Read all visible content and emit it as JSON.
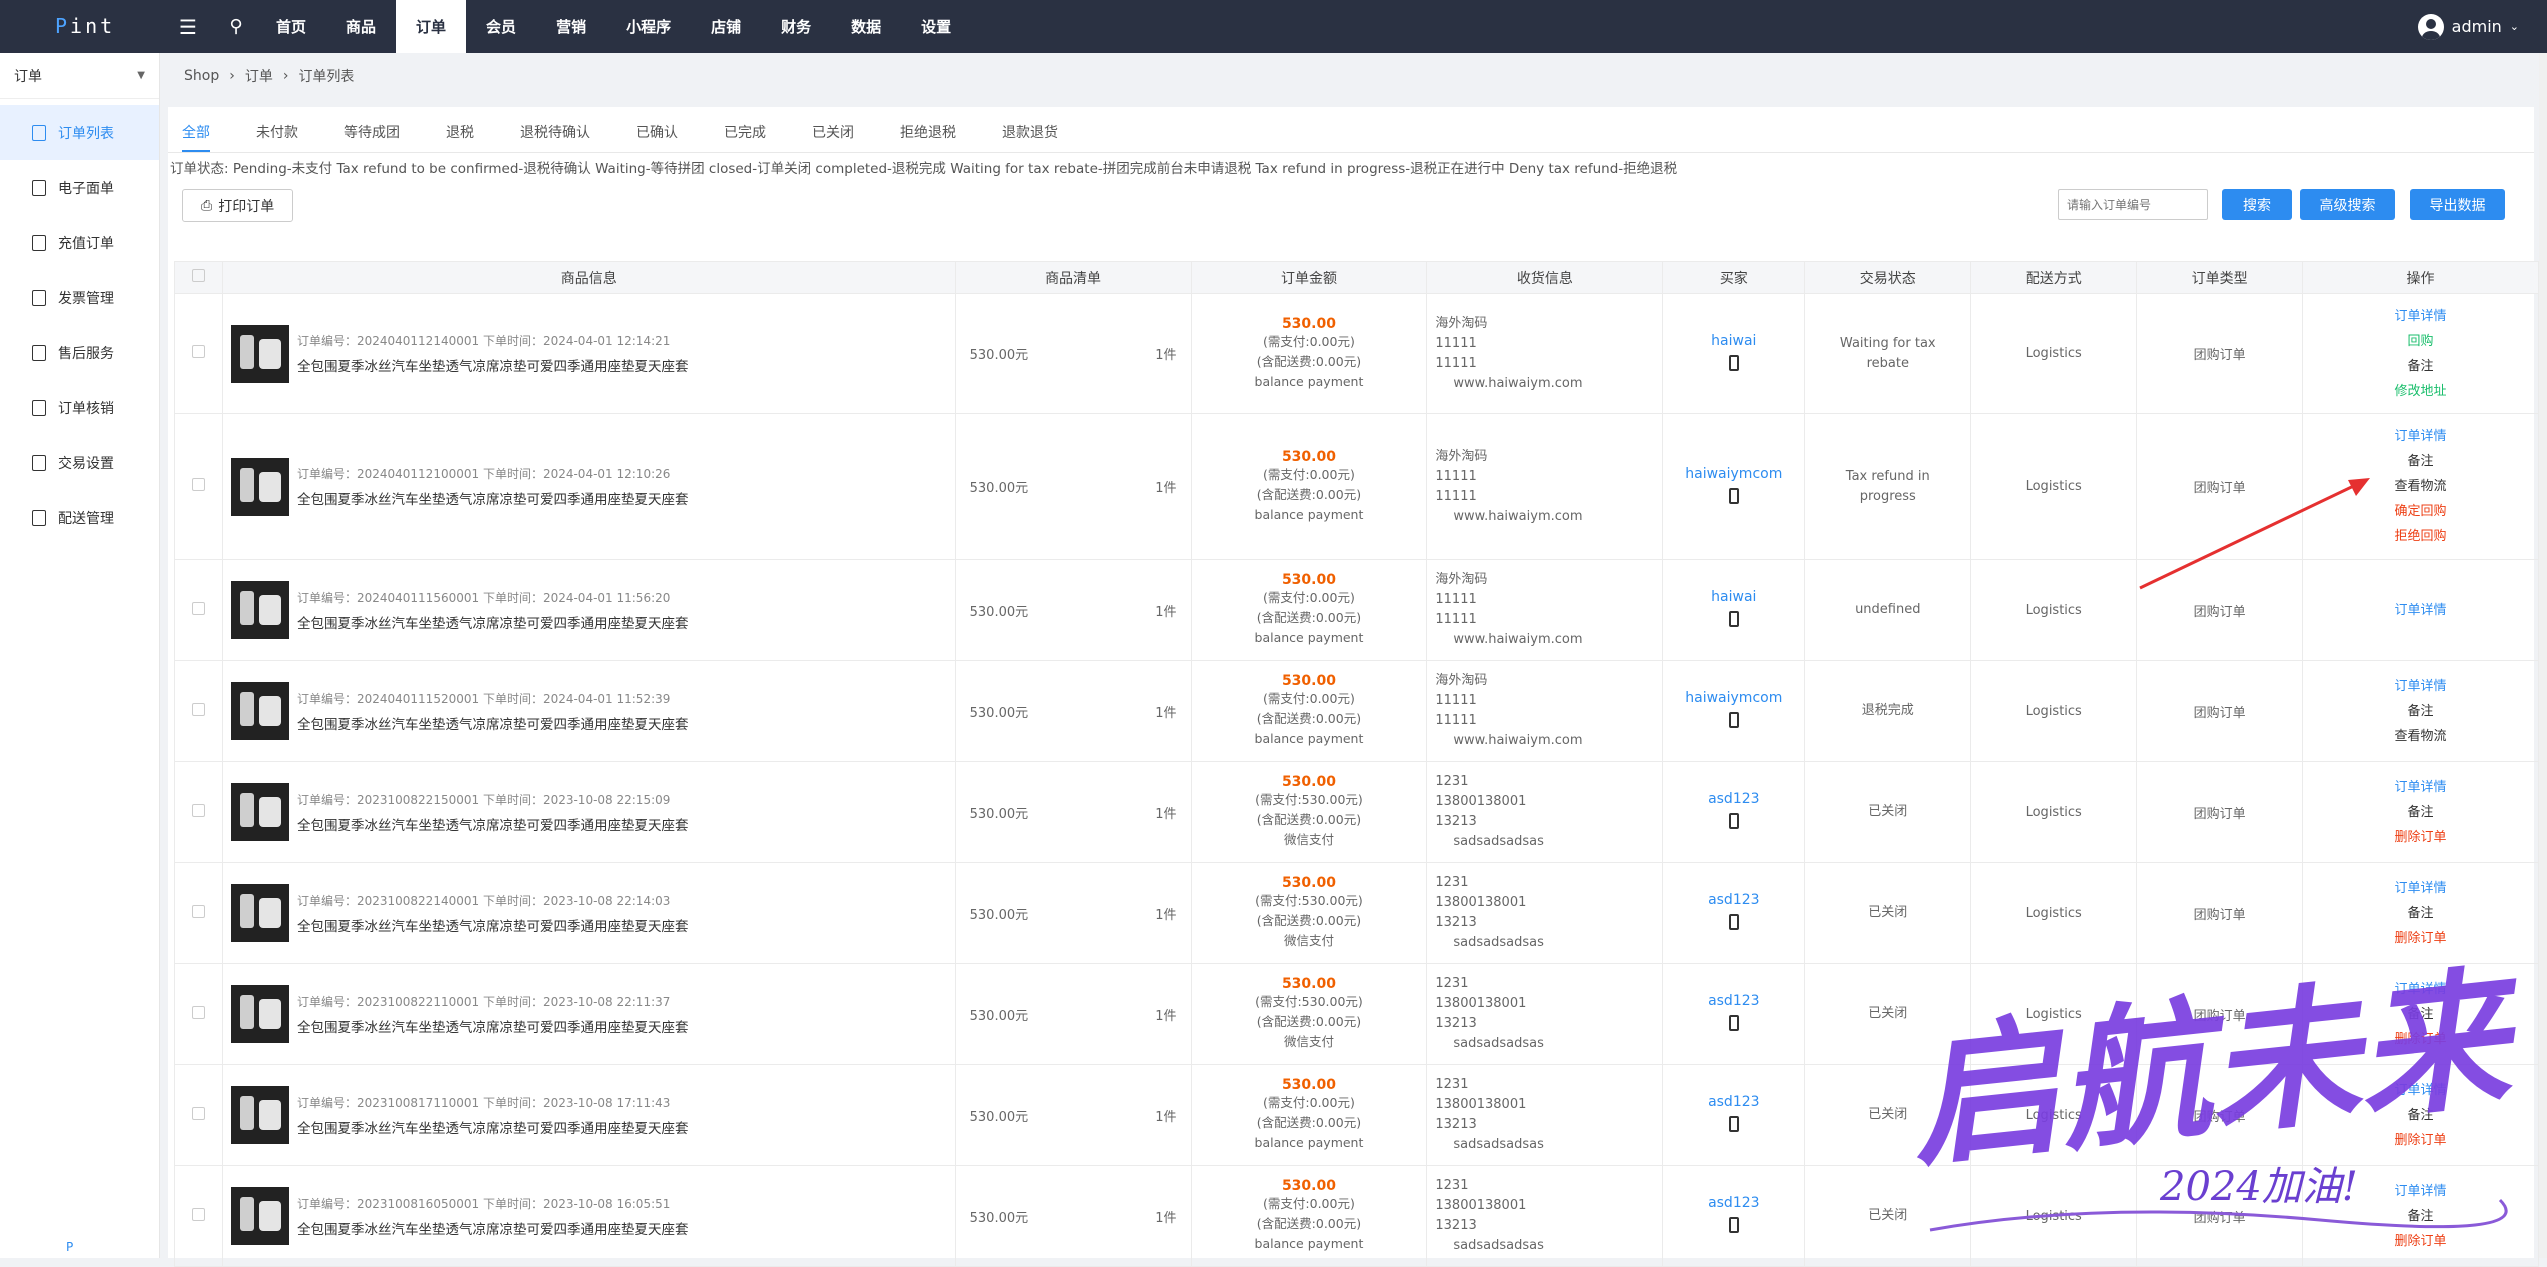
{
  "topbar": {
    "logo_p": "P",
    "logo_rest": "int",
    "nav": [
      "首页",
      "商品",
      "订单",
      "会员",
      "营销",
      "小程序",
      "店铺",
      "财务",
      "数据",
      "设置"
    ],
    "active_nav": 2,
    "user": "admin"
  },
  "sidebar": {
    "head": "订单",
    "items": [
      "订单列表",
      "电子面单",
      "充值订单",
      "发票管理",
      "售后服务",
      "订单核销",
      "交易设置",
      "配送管理"
    ],
    "active": 0,
    "foot": "P"
  },
  "breadcrumb": [
    "Shop",
    "订单",
    "订单列表"
  ],
  "tabs": [
    "全部",
    "未付款",
    "等待成团",
    "退税",
    "退税待确认",
    "已确认",
    "已完成",
    "已关闭",
    "拒绝退税",
    "退款退货"
  ],
  "active_tab": 0,
  "status_text": "订单状态: Pending-未支付 Tax refund to be confirmed-退税待确认 Waiting-等待拼团 closed-订单关闭 completed-退税完成 Waiting for tax rebate-拼团完成前台未申请退税 Tax refund in progress-退税正在进行中 Deny tax refund-拒绝退税",
  "toolbar": {
    "print": "打印订单",
    "search_placeholder": "请输入订单编号",
    "search": "搜索",
    "advanced": "高级搜索",
    "export": "导出数据"
  },
  "columns": [
    "商品信息",
    "商品清单",
    "订单金额",
    "收货信息",
    "买家",
    "交易状态",
    "配送方式",
    "订单类型",
    "操作"
  ],
  "goods_name": "全包围夏季冰丝汽车坐垫透气凉席凉垫可爱四季通用座垫夏天座套",
  "rows": [
    {
      "meta": "订单编号：2024040112140001 下单时间：2024-04-01 12:14:21",
      "price": "530.00元",
      "qty": "1件",
      "amount": "530.00",
      "need": "(需支付:0.00元)",
      "ship": "(含配送费:0.00元)",
      "pay": "balance payment",
      "r1": "海外淘码",
      "r2": "11111",
      "r3": "11111",
      "r4": "www.haiwaiym.com",
      "buyer": "haiwai",
      "status": "Waiting for tax rebate",
      "delivery": "Logistics",
      "type": "团购订单",
      "ops": [
        [
          "订单详情",
          "op-blue"
        ],
        [
          "回购",
          "op-green"
        ],
        [
          "备注",
          "op-dark"
        ],
        [
          "修改地址",
          "op-green2"
        ]
      ]
    },
    {
      "meta": "订单编号：2024040112100001 下单时间：2024-04-01 12:10:26",
      "price": "530.00元",
      "qty": "1件",
      "amount": "530.00",
      "need": "(需支付:0.00元)",
      "ship": "(含配送费:0.00元)",
      "pay": "balance payment",
      "r1": "海外淘码",
      "r2": "11111",
      "r3": "11111",
      "r4": "www.haiwaiym.com",
      "buyer": "haiwaiymcom",
      "status": "Tax refund in progress",
      "delivery": "Logistics",
      "type": "团购订单",
      "ops": [
        [
          "订单详情",
          "op-blue"
        ],
        [
          "备注",
          "op-dark"
        ],
        [
          "查看物流",
          "op-dark"
        ],
        [
          "确定回购",
          "op-red"
        ],
        [
          "拒绝回购",
          "op-red"
        ]
      ]
    },
    {
      "meta": "订单编号：2024040111560001 下单时间：2024-04-01 11:56:20",
      "price": "530.00元",
      "qty": "1件",
      "amount": "530.00",
      "need": "(需支付:0.00元)",
      "ship": "(含配送费:0.00元)",
      "pay": "balance payment",
      "r1": "海外淘码",
      "r2": "11111",
      "r3": "11111",
      "r4": "www.haiwaiym.com",
      "buyer": "haiwai",
      "status": "undefined",
      "delivery": "Logistics",
      "type": "团购订单",
      "ops": [
        [
          "订单详情",
          "op-blue"
        ]
      ]
    },
    {
      "meta": "订单编号：2024040111520001 下单时间：2024-04-01 11:52:39",
      "price": "530.00元",
      "qty": "1件",
      "amount": "530.00",
      "need": "(需支付:0.00元)",
      "ship": "(含配送费:0.00元)",
      "pay": "balance payment",
      "r1": "海外淘码",
      "r2": "11111",
      "r3": "11111",
      "r4": "www.haiwaiym.com",
      "buyer": "haiwaiymcom",
      "status": "退税完成",
      "delivery": "Logistics",
      "type": "团购订单",
      "ops": [
        [
          "订单详情",
          "op-blue"
        ],
        [
          "备注",
          "op-dark"
        ],
        [
          "查看物流",
          "op-dark"
        ]
      ]
    },
    {
      "meta": "订单编号：2023100822150001 下单时间：2023-10-08 22:15:09",
      "price": "530.00元",
      "qty": "1件",
      "amount": "530.00",
      "need": "(需支付:530.00元)",
      "ship": "(含配送费:0.00元)",
      "pay": "微信支付",
      "r1": "1231",
      "r2": "13800138001",
      "r3": "13213",
      "r4": "sadsadsadsas",
      "buyer": "asd123",
      "status": "已关闭",
      "delivery": "Logistics",
      "type": "团购订单",
      "ops": [
        [
          "订单详情",
          "op-blue"
        ],
        [
          "备注",
          "op-dark"
        ],
        [
          "删除订单",
          "op-red"
        ]
      ]
    },
    {
      "meta": "订单编号：2023100822140001 下单时间：2023-10-08 22:14:03",
      "price": "530.00元",
      "qty": "1件",
      "amount": "530.00",
      "need": "(需支付:530.00元)",
      "ship": "(含配送费:0.00元)",
      "pay": "微信支付",
      "r1": "1231",
      "r2": "13800138001",
      "r3": "13213",
      "r4": "sadsadsadsas",
      "buyer": "asd123",
      "status": "已关闭",
      "delivery": "Logistics",
      "type": "团购订单",
      "ops": [
        [
          "订单详情",
          "op-blue"
        ],
        [
          "备注",
          "op-dark"
        ],
        [
          "删除订单",
          "op-red"
        ]
      ]
    },
    {
      "meta": "订单编号：2023100822110001 下单时间：2023-10-08 22:11:37",
      "price": "530.00元",
      "qty": "1件",
      "amount": "530.00",
      "need": "(需支付:530.00元)",
      "ship": "(含配送费:0.00元)",
      "pay": "微信支付",
      "r1": "1231",
      "r2": "13800138001",
      "r3": "13213",
      "r4": "sadsadsadsas",
      "buyer": "asd123",
      "status": "已关闭",
      "delivery": "Logistics",
      "type": "团购订单",
      "ops": [
        [
          "订单详情",
          "op-blue"
        ],
        [
          "备注",
          "op-dark"
        ],
        [
          "删除订单",
          "op-red"
        ]
      ]
    },
    {
      "meta": "订单编号：2023100817110001 下单时间：2023-10-08 17:11:43",
      "price": "530.00元",
      "qty": "1件",
      "amount": "530.00",
      "need": "(需支付:0.00元)",
      "ship": "(含配送费:0.00元)",
      "pay": "balance payment",
      "r1": "1231",
      "r2": "13800138001",
      "r3": "13213",
      "r4": "sadsadsadsas",
      "buyer": "asd123",
      "status": "已关闭",
      "delivery": "Logistics",
      "type": "团购订单",
      "ops": [
        [
          "订单详情",
          "op-blue"
        ],
        [
          "备注",
          "op-dark"
        ],
        [
          "删除订单",
          "op-red"
        ]
      ]
    },
    {
      "meta": "订单编号：2023100816050001 下单时间：2023-10-08 16:05:51",
      "price": "530.00元",
      "qty": "1件",
      "amount": "530.00",
      "need": "(需支付:0.00元)",
      "ship": "(含配送费:0.00元)",
      "pay": "balance payment",
      "r1": "1231",
      "r2": "13800138001",
      "r3": "13213",
      "r4": "sadsadsadsas",
      "buyer": "asd123",
      "status": "已关闭",
      "delivery": "Logistics",
      "type": "团购订单",
      "ops": [
        [
          "订单详情",
          "op-blue"
        ],
        [
          "备注",
          "op-dark"
        ],
        [
          "删除订单",
          "op-red"
        ]
      ]
    }
  ],
  "watermark": {
    "main": "启航未来",
    "sub": "2024加油!"
  },
  "colors": {
    "topbar": "#2a3142",
    "accent": "#2d8cf0",
    "price": "#f06000",
    "danger": "#ed3f14",
    "success": "#19be6b"
  }
}
